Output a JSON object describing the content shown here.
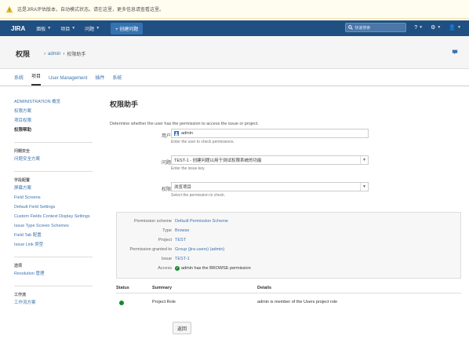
{
  "banner": {
    "text": "这是JIRA评估版本，自动模式状态。请在这里，更多信息请查看这里。"
  },
  "topnav": {
    "brand": "JIRA",
    "items": [
      {
        "label": "面板"
      },
      {
        "label": "项目"
      },
      {
        "label": "问题"
      }
    ],
    "create_label": "+ 创建问题",
    "search_placeholder": "快速搜索",
    "help_label": "?",
    "settings_label": "⚙",
    "user_label": "👤"
  },
  "header": {
    "space_title": "权限",
    "breadcrumb": [
      "admin",
      "权限助手"
    ]
  },
  "tabs": [
    {
      "label": "系统"
    },
    {
      "label": "项目",
      "active": true
    },
    {
      "label": "User Management"
    },
    {
      "label": "插件"
    },
    {
      "label": "系统"
    }
  ],
  "sidebar": {
    "groups": [
      {
        "heading": "",
        "items": [
          {
            "label": "ADMINISTRATION 概览"
          },
          {
            "label": "权限方案"
          },
          {
            "label": "项目权限"
          },
          {
            "label": "权限帮助"
          }
        ]
      },
      {
        "heading": "问题安全",
        "items": [
          {
            "label": "问题安全方案"
          }
        ]
      },
      {
        "heading": "字段配置",
        "items": [
          {
            "label": "屏幕方案"
          },
          {
            "label": "Field Screens"
          },
          {
            "label": "Default Field Settings"
          },
          {
            "label": "Custom Fields Context Display Settings"
          },
          {
            "label": "Issue Type Screen Schemes"
          },
          {
            "label": "Field Tab 配置"
          },
          {
            "label": "Issue Link 类型"
          }
        ]
      },
      {
        "heading": "选项",
        "items": [
          {
            "label": "Resolution 管理"
          }
        ]
      },
      {
        "heading": "工作流",
        "items": [
          {
            "label": "工作流方案"
          }
        ]
      }
    ]
  },
  "content": {
    "title": "权限助手",
    "description": "Determine whether the user has the permission to access the issue or project.",
    "user": {
      "label": "用户",
      "value": "admin",
      "help": "Enter the user to check permissions."
    },
    "issue": {
      "label": "问题",
      "value": "TEST-1 - 创建问题以用于测试权限系统的功能",
      "help": "Enter the issue key."
    },
    "permission": {
      "label": "权限",
      "value": "浏览项目",
      "help": "Select the permission to check."
    }
  },
  "info": {
    "rows": [
      {
        "key": "Permission scheme",
        "value": "Default Permission Scheme"
      },
      {
        "key": "Type",
        "value": "Browse"
      },
      {
        "key": "Project",
        "value": "TEST"
      },
      {
        "key": "Permission granted to",
        "value": "Group (jira-users) (admin)"
      },
      {
        "key": "Issue",
        "value": "TEST-1"
      },
      {
        "key": "Access",
        "value": "admin has the BROWSE permission"
      }
    ]
  },
  "results": {
    "headers": [
      "Status",
      "Summary",
      "Details"
    ],
    "row": {
      "summary": "Project Role",
      "details": "admin is member of the Users project role"
    }
  },
  "back_label": "返回"
}
